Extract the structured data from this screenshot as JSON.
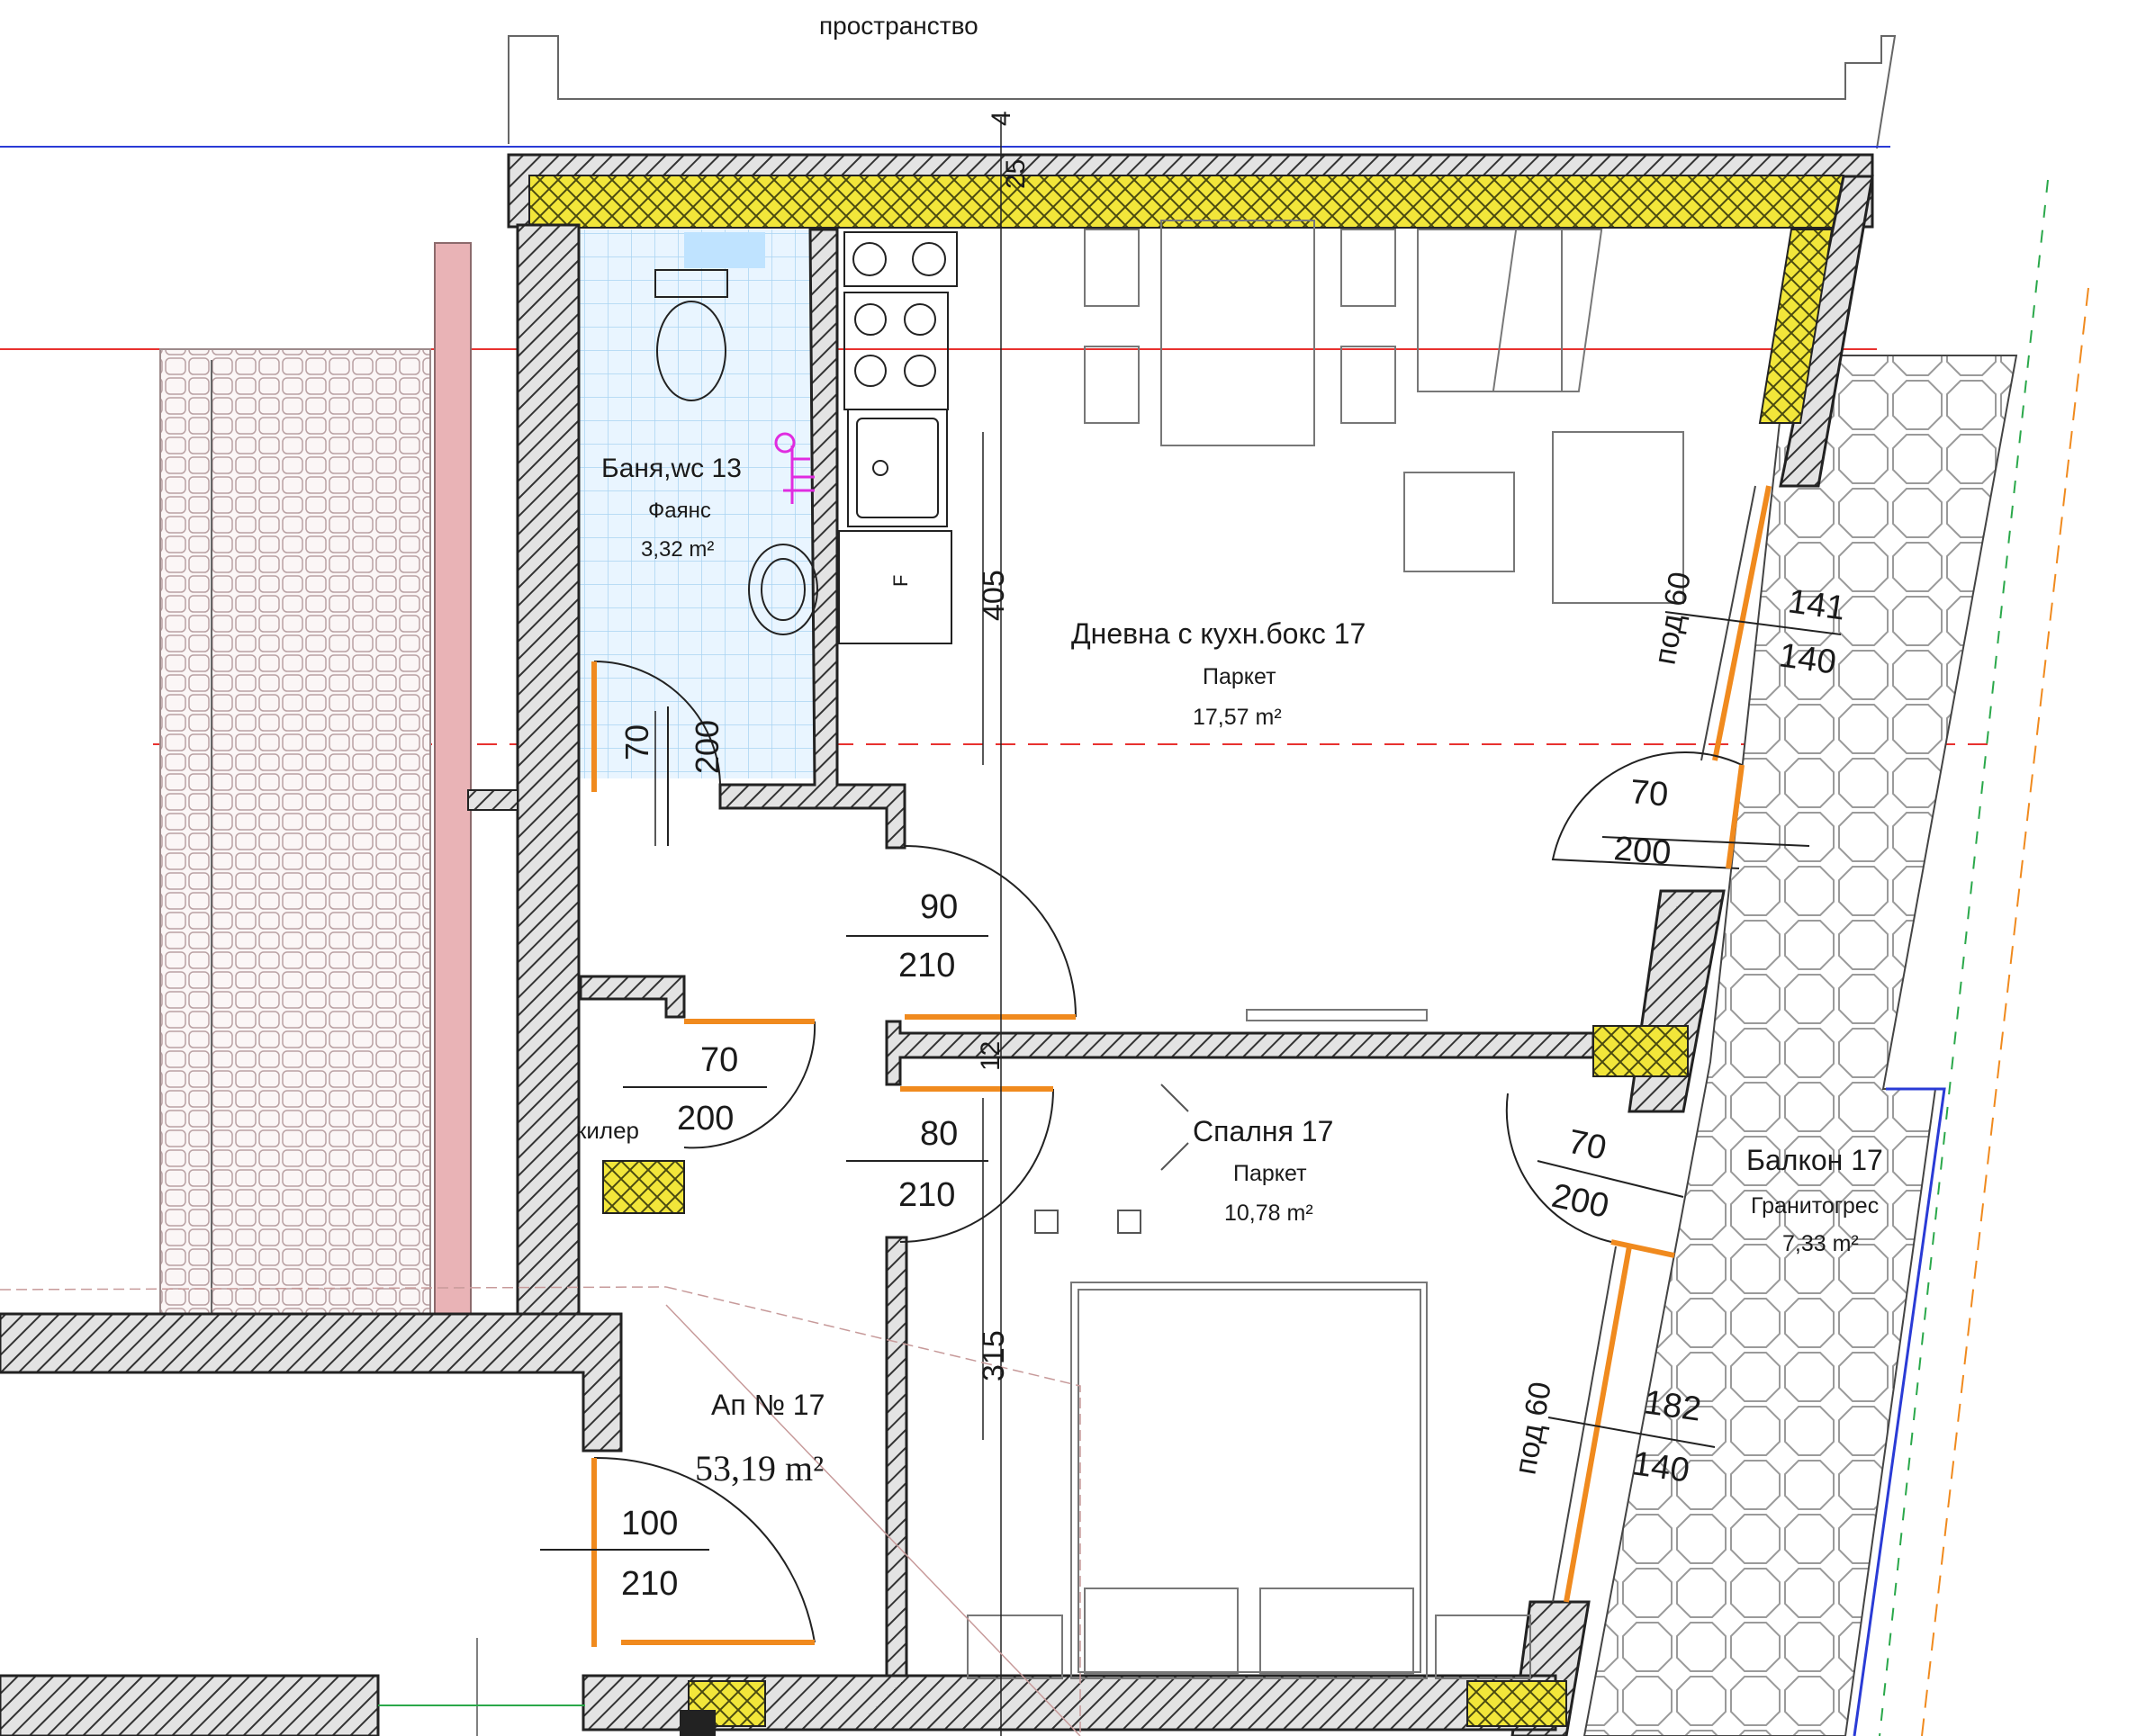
{
  "top_note": "пространство",
  "rooms": {
    "bath": {
      "name": "Баня,wc 13",
      "finish": "Фаянс",
      "area": "3,32 m²"
    },
    "living": {
      "name": "Дневна с кухн.бокс 17",
      "finish": "Паркет",
      "area": "17,57 m²"
    },
    "bedroom": {
      "name": "Спалня 17",
      "finish": "Паркет",
      "area": "10,78 m²"
    },
    "balcony": {
      "name": "Балкон 17",
      "finish": "Гранитогрес",
      "area": "7,33 m²"
    },
    "apartment": {
      "name": "Ап № 17",
      "area": "53,19 m²"
    },
    "pantry": {
      "name": "килер"
    }
  },
  "fridge_mark": "F",
  "dimensions": {
    "top_wall": "25",
    "top_wall_b": "4",
    "living_height": "405",
    "bedroom_height": "315",
    "partition": "12"
  },
  "windows": {
    "living": {
      "sill": "под 60",
      "width": "141",
      "height": "140"
    },
    "bedroom": {
      "sill": "под 60",
      "width": "182",
      "height": "140"
    }
  },
  "doors": {
    "bath": {
      "width": "70",
      "height": "200"
    },
    "living": {
      "width": "90",
      "height": "210"
    },
    "pantry": {
      "width": "70",
      "height": "200"
    },
    "bedroom": {
      "width": "80",
      "height": "210"
    },
    "living_balcony": {
      "width": "70",
      "height": "200"
    },
    "bedroom_balcony": {
      "width": "70",
      "height": "200"
    },
    "entrance": {
      "width": "100",
      "height": "210"
    }
  },
  "colors": {
    "wall_fill": "#d8d8d8",
    "insulation": "#f4ea3c",
    "door": "#f08a1e",
    "tile": "#bfe3ff",
    "red_line": "#e8312f",
    "blue_line": "#2a3bd6",
    "green_line": "#2aa84a",
    "pink_column": "#e9b3b6"
  }
}
